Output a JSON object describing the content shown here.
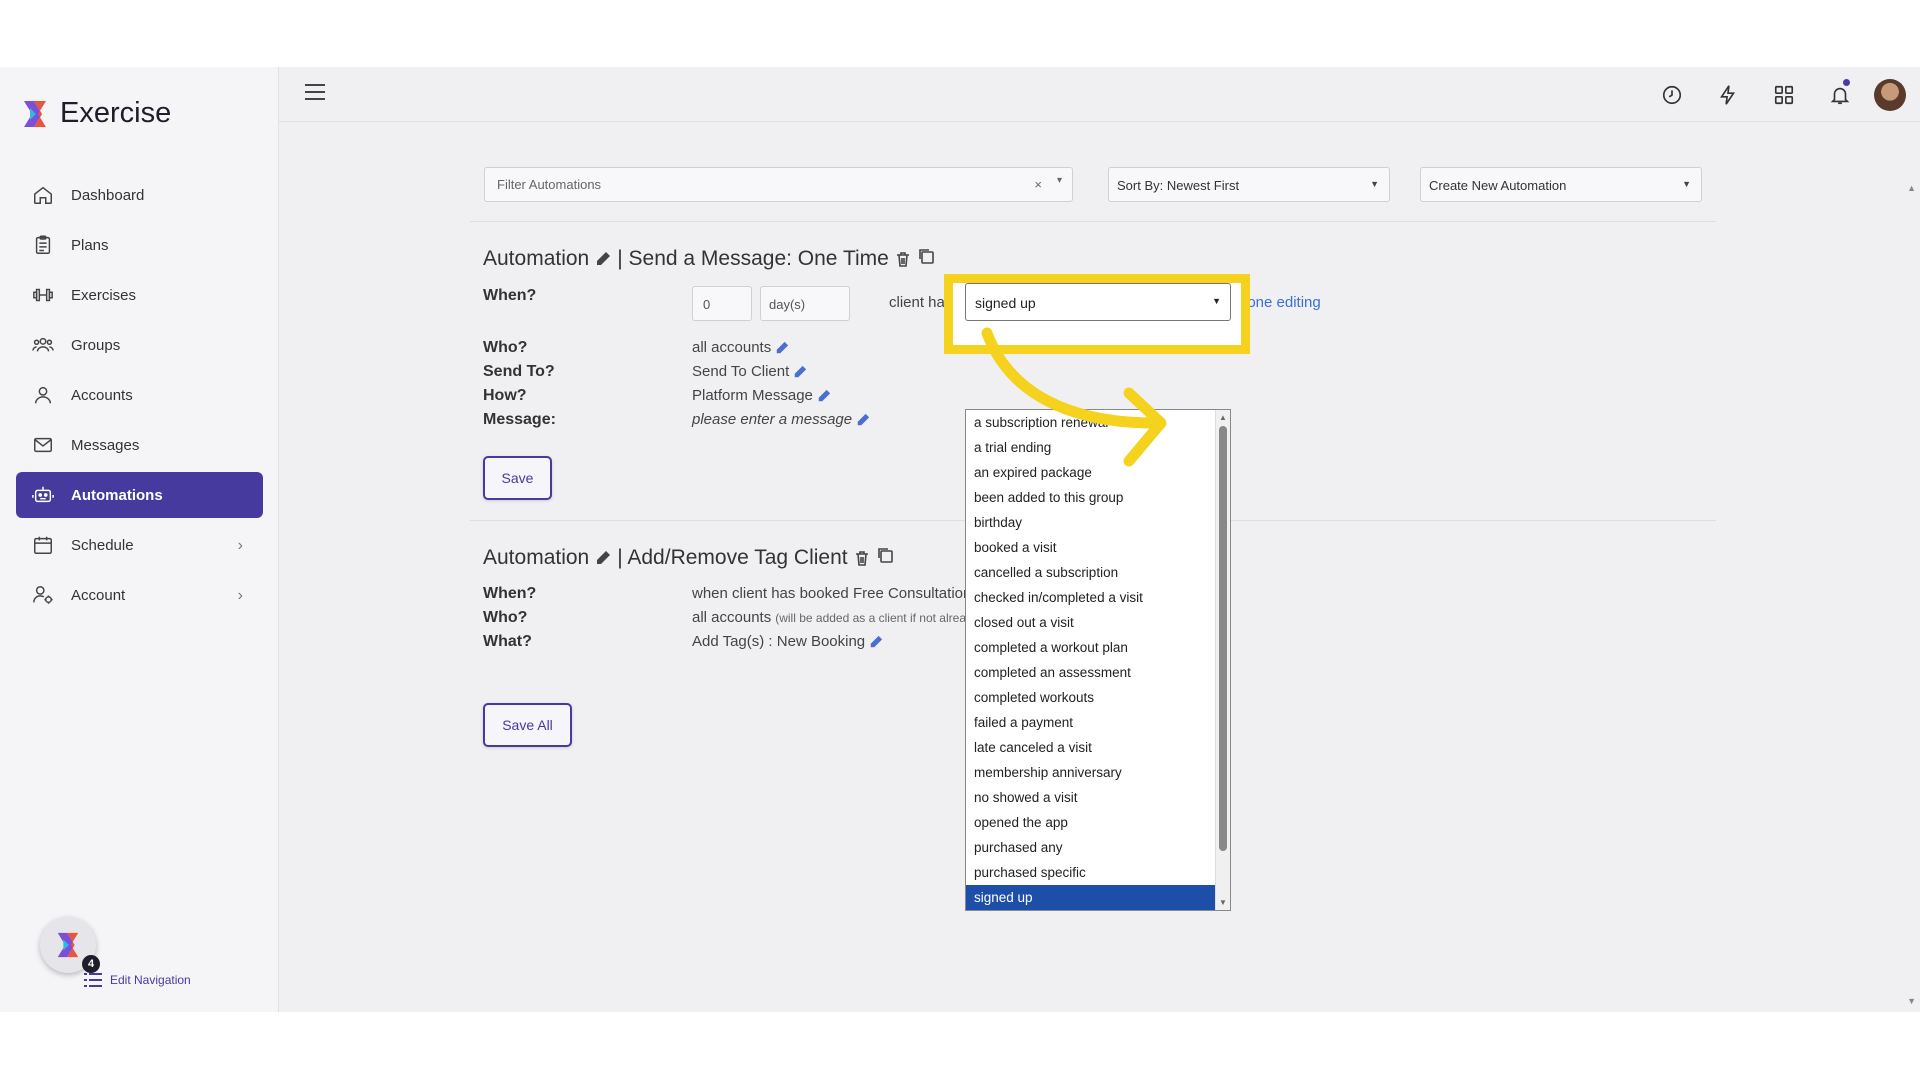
{
  "app": {
    "name": "Exercise"
  },
  "sidebar": {
    "items": [
      {
        "label": "Dashboard",
        "icon": "home-icon"
      },
      {
        "label": "Plans",
        "icon": "clipboard-icon"
      },
      {
        "label": "Exercises",
        "icon": "dumbbell-icon"
      },
      {
        "label": "Groups",
        "icon": "users-icon"
      },
      {
        "label": "Accounts",
        "icon": "user-icon"
      },
      {
        "label": "Messages",
        "icon": "mail-icon"
      },
      {
        "label": "Automations",
        "icon": "robot-icon",
        "active": true
      },
      {
        "label": "Schedule",
        "icon": "calendar-icon",
        "has_submenu": true
      },
      {
        "label": "Account",
        "icon": "user-gear-icon",
        "has_submenu": true
      }
    ],
    "badge_count": "4",
    "edit_navigation": "Edit Navigation"
  },
  "toolbar": {
    "filter_placeholder": "Filter Automations",
    "filter_clear": "×",
    "sort_label": "Sort By: Newest First",
    "create_label": "Create New Automation"
  },
  "automation1": {
    "title_prefix": "Automation",
    "title_suffix": "| Send a Message: One Time",
    "when_label": "When?",
    "when_number": "0",
    "when_unit": "day(s)",
    "when_text": "client has",
    "trigger_value": "signed up",
    "done_editing": "done editing",
    "who_label": "Who?",
    "who_value": "all accounts",
    "send_to_label": "Send To?",
    "send_to_value": "Send To Client",
    "how_label": "How?",
    "how_value": "Platform Message",
    "message_label": "Message:",
    "message_value": "please enter a message",
    "save_button": "Save"
  },
  "automation2": {
    "title_prefix": "Automation",
    "title_suffix": "| Add/Remove Tag Client",
    "when_label": "When?",
    "when_value": "when client has booked Free Consultation",
    "who_label": "Who?",
    "who_value": "all accounts",
    "who_note": "(will be added as a client if not already)",
    "what_label": "What?",
    "what_value": "Add Tag(s) : New Booking",
    "save_all_button": "Save All"
  },
  "trigger_options": [
    "a subscription renewal",
    "a trial ending",
    "an expired package",
    "been added to this group",
    "birthday",
    "booked a visit",
    "cancelled a subscription",
    "checked in/completed a visit",
    "closed out a visit",
    "completed a workout plan",
    "completed an assessment",
    "completed workouts",
    "failed a payment",
    "late canceled a visit",
    "membership anniversary",
    "no showed a visit",
    "opened the app",
    "purchased any",
    "purchased specific",
    "signed up"
  ],
  "colors": {
    "accent": "#473a9e",
    "highlight": "#f5d21e",
    "selected_option": "#1e4fa8",
    "link": "#3b6fd6"
  }
}
